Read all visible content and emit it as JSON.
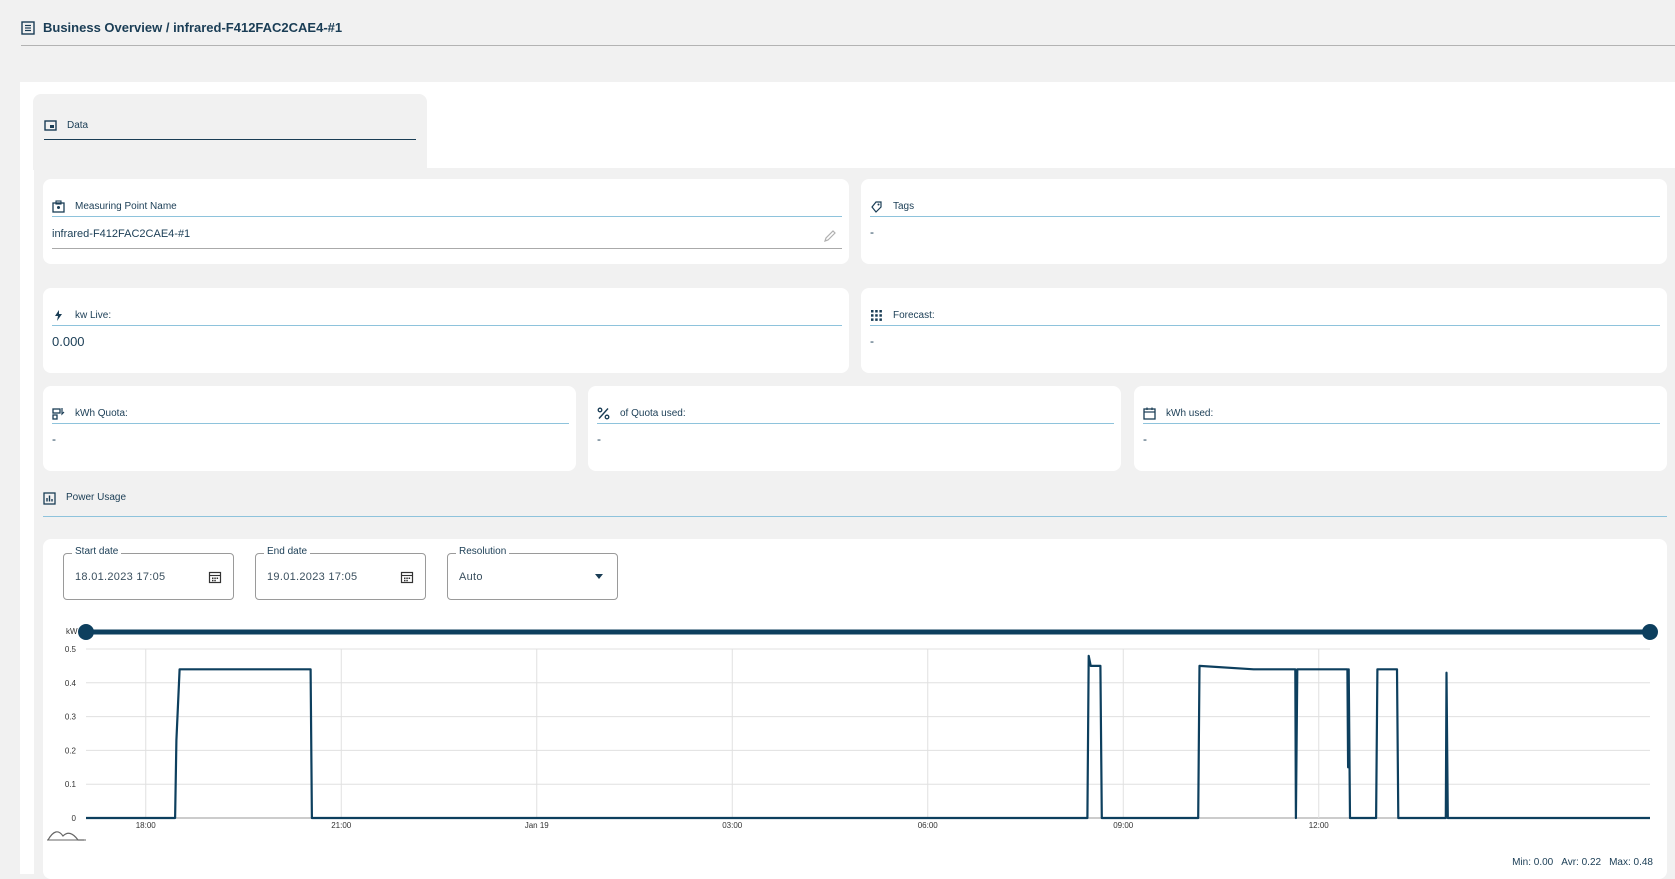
{
  "header": {
    "title": "Business Overview / infrared-F412FAC2CAE4-#1"
  },
  "tabs": [
    {
      "label": "Data"
    }
  ],
  "cards": {
    "measuring_point": {
      "label": "Measuring Point Name",
      "value": "infrared-F412FAC2CAE4-#1"
    },
    "tags": {
      "label": "Tags",
      "value": "-"
    },
    "kw_live": {
      "label": "kw Live:",
      "value": "0.000"
    },
    "forecast": {
      "label": "Forecast:",
      "value": "-"
    },
    "kwh_quota": {
      "label": "kWh Quota:",
      "value": "-"
    },
    "quota_used": {
      "label": "of Quota used:",
      "value": "-"
    },
    "kwh_used": {
      "label": "kWh used:",
      "value": "-"
    }
  },
  "power_usage": {
    "title": "Power Usage",
    "start_date": {
      "label": "Start date",
      "value": "18.01.2023 17:05"
    },
    "end_date": {
      "label": "End date",
      "value": "19.01.2023 17:05"
    },
    "resolution": {
      "label": "Resolution",
      "value": "Auto"
    },
    "stats": {
      "min": "Min: 0.00",
      "avg": "Avr: 0.22",
      "max": "Max: 0.48"
    }
  },
  "colors": {
    "primary": "#0d3f5e",
    "accent_line": "#8ec3dc",
    "background": "#f1f1f1"
  },
  "chart_data": {
    "type": "line",
    "ylabel": "kW",
    "ylim": [
      0,
      0.5
    ],
    "yticks": [
      "0",
      "0.1",
      "0.2",
      "0.3",
      "0.4",
      "0.5"
    ],
    "xlim": [
      17.083,
      41.083
    ],
    "xticks": [
      {
        "label": "18:00",
        "x": 18
      },
      {
        "label": "21:00",
        "x": 21
      },
      {
        "label": "Jan 19",
        "x": 24
      },
      {
        "label": "03:00",
        "x": 27
      },
      {
        "label": "06:00",
        "x": 30
      },
      {
        "label": "09:00",
        "x": 33
      },
      {
        "label": "12:00",
        "x": 36
      }
    ],
    "grid": true,
    "series": [
      {
        "points": [
          [
            17.083,
            0
          ],
          [
            18.45,
            0
          ],
          [
            18.47,
            0.23
          ],
          [
            18.52,
            0.44
          ],
          [
            19.5,
            0.44
          ],
          [
            20.5,
            0.44
          ],
          [
            20.53,
            0.44
          ],
          [
            20.55,
            0
          ],
          [
            29.0,
            0
          ],
          [
            32.45,
            0
          ],
          [
            32.47,
            0.48
          ],
          [
            32.5,
            0.45
          ],
          [
            32.65,
            0.45
          ],
          [
            32.67,
            0
          ],
          [
            34.15,
            0
          ],
          [
            34.17,
            0.45
          ],
          [
            35.0,
            0.44
          ],
          [
            35.64,
            0.44
          ],
          [
            35.65,
            0.0
          ],
          [
            35.67,
            0.44
          ],
          [
            36.4,
            0.44
          ],
          [
            36.44,
            0.44
          ],
          [
            36.45,
            0.15
          ],
          [
            36.46,
            0.44
          ],
          [
            36.48,
            0
          ],
          [
            36.88,
            0
          ],
          [
            36.9,
            0.44
          ],
          [
            37.2,
            0.44
          ],
          [
            37.22,
            0
          ],
          [
            37.95,
            0
          ],
          [
            37.96,
            0.43
          ],
          [
            37.98,
            0
          ],
          [
            41.083,
            0
          ]
        ]
      }
    ]
  }
}
